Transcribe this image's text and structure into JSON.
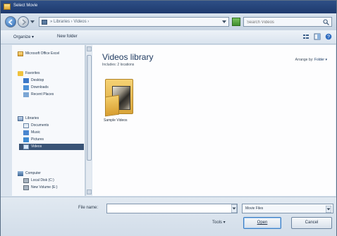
{
  "window": {
    "title": "Select Movie"
  },
  "address": {
    "breadcrumb": "» Libraries › Videos ›",
    "search_placeholder": "Search Videos"
  },
  "toolbar": {
    "organize_label": "Organize ▾",
    "new_folder_label": "New folder"
  },
  "nav": {
    "items": [
      {
        "label": "Microsoft Office Excel",
        "icon": "excel-icon"
      },
      {
        "label": "Favorites",
        "icon": "star-icon"
      },
      {
        "label": "Desktop",
        "icon": "desktop-icon"
      },
      {
        "label": "Downloads",
        "icon": "downloads-icon"
      },
      {
        "label": "Recent Places",
        "icon": "recent-places-icon"
      },
      {
        "label": "Libraries",
        "icon": "libraries-icon"
      },
      {
        "label": "Documents",
        "icon": "documents-icon"
      },
      {
        "label": "Music",
        "icon": "music-icon"
      },
      {
        "label": "Pictures",
        "icon": "pictures-icon"
      },
      {
        "label": "Videos",
        "icon": "videos-icon",
        "selected": true
      },
      {
        "label": "Computer",
        "icon": "computer-icon"
      },
      {
        "label": "Local Disk (C:)",
        "icon": "disk-icon"
      },
      {
        "label": "New Volume (E:)",
        "icon": "disk-icon"
      }
    ]
  },
  "content": {
    "title": "Videos library",
    "subtitle": "Includes: 2 locations",
    "arrange_label": "Arrange by:",
    "arrange_value": "Folder ▾",
    "folders": [
      {
        "label": "Sample Videos"
      }
    ]
  },
  "bottom": {
    "filename_label": "File name:",
    "filename_value": "",
    "file_type": "Movie Files",
    "tools_label": "Tools ▾",
    "open_label": "Open",
    "cancel_label": "Cancel"
  }
}
